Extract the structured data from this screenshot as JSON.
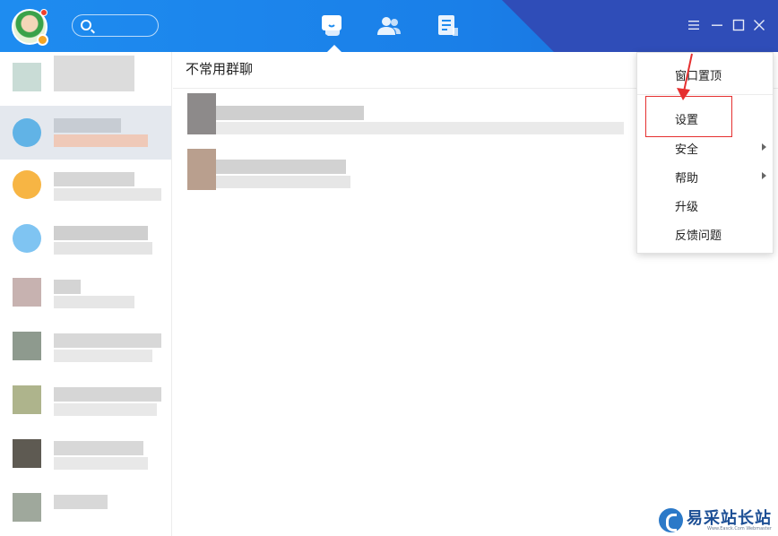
{
  "titlebar": {
    "nav": [
      {
        "name": "messages-icon"
      },
      {
        "name": "contacts-icon"
      },
      {
        "name": "documents-icon"
      }
    ],
    "window_buttons": [
      "menu-icon",
      "minimize-icon",
      "maximize-icon",
      "close-icon"
    ],
    "colors": {
      "primary": "#1e8cf0",
      "dark": "#2f4db8"
    }
  },
  "main": {
    "title": "不常用群聊"
  },
  "menu": {
    "items": [
      {
        "label": "窗口置顶",
        "has_submenu": false
      },
      {
        "label": "设置",
        "has_submenu": false,
        "highlighted": true
      },
      {
        "label": "安全",
        "has_submenu": true
      },
      {
        "label": "帮助",
        "has_submenu": true
      },
      {
        "label": "升级",
        "has_submenu": false
      },
      {
        "label": "反馈问题",
        "has_submenu": false
      }
    ]
  },
  "annotation": {
    "highlight_color": "#e53030"
  },
  "watermark": {
    "title": "易采站长站",
    "subtitle": "Www.Easck.Com Webmaster"
  }
}
